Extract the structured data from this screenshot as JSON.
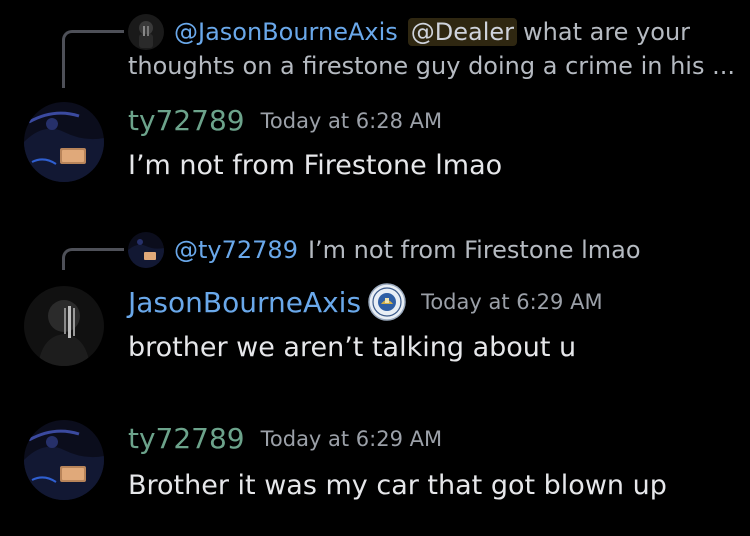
{
  "messages": [
    {
      "reply": {
        "author": "@JasonBourneAxis",
        "mention": "@Dealer",
        "line1": "what are your",
        "line2": "thoughts on a firestone guy doing a crime in his ..."
      },
      "author": "ty72789",
      "timestamp": "Today at 6:28 AM",
      "text": "I’m not from Firestone lmao"
    },
    {
      "reply": {
        "author": "@ty72789",
        "text": "I’m not from Firestone lmao"
      },
      "author": "JasonBourneAxis",
      "timestamp": "Today at 6:29 AM",
      "text": "brother we aren’t talking about u"
    },
    {
      "author": "ty72789",
      "timestamp": "Today at 6:29 AM",
      "text": "Brother it was my car that got blown up"
    }
  ],
  "colors": {
    "background": "#000000",
    "username_ty": "#6ca38b",
    "username_jason": "#6aa8ea",
    "timestamp": "#9ba0a8",
    "message_text": "#e6e7ea",
    "reply_text": "#b5bac1"
  },
  "icons": {
    "avatar_ty": "car-interior-avatar-icon",
    "avatar_jason": "dark-figure-avatar-icon",
    "badge": "seal-badge-icon"
  }
}
